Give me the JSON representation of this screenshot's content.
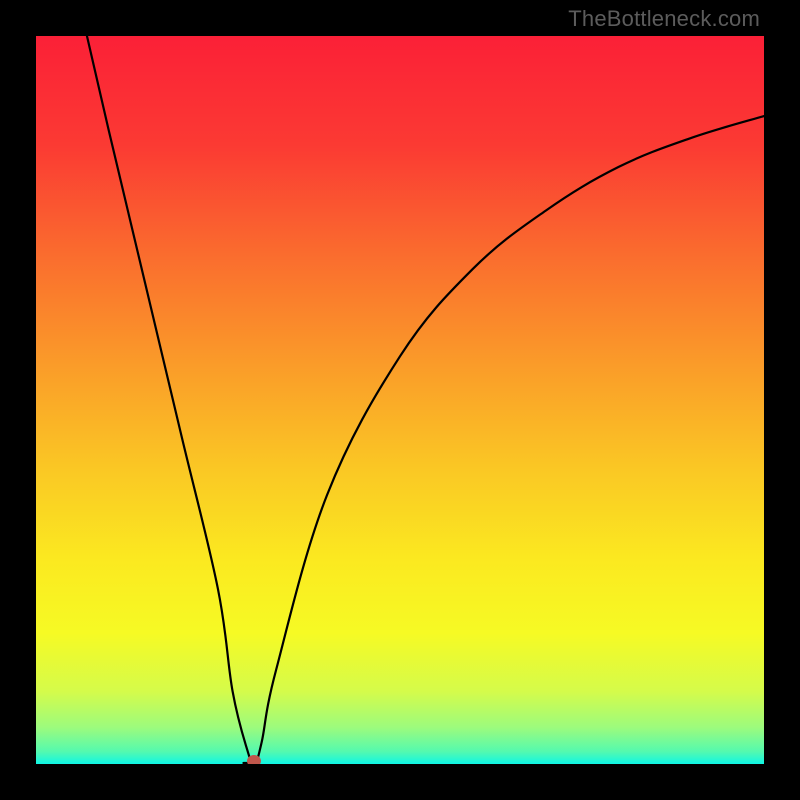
{
  "watermark": "TheBottleneck.com",
  "chart_data": {
    "type": "line",
    "title": "",
    "xlabel": "",
    "ylabel": "",
    "xlim": [
      0,
      100
    ],
    "ylim": [
      0,
      100
    ],
    "grid": false,
    "legend_position": "none",
    "series": [
      {
        "name": "bottleneck-curve",
        "x": [
          7,
          10,
          15,
          20,
          25,
          27,
          29,
          30,
          31,
          33,
          40,
          50,
          60,
          70,
          80,
          90,
          100
        ],
        "y": [
          100,
          87,
          66,
          45,
          24,
          10,
          2,
          0,
          3,
          13,
          37,
          56,
          68,
          76,
          82,
          86,
          89
        ]
      }
    ],
    "markers": [
      {
        "name": "optimum",
        "x": 30,
        "y": 0,
        "color": "#c0574c"
      }
    ],
    "background_gradient": {
      "stops": [
        {
          "pos": 0.0,
          "color": "#fb2037"
        },
        {
          "pos": 0.15,
          "color": "#fb3a33"
        },
        {
          "pos": 0.3,
          "color": "#fa6c2e"
        },
        {
          "pos": 0.45,
          "color": "#fa9b29"
        },
        {
          "pos": 0.6,
          "color": "#fac924"
        },
        {
          "pos": 0.72,
          "color": "#fbe920"
        },
        {
          "pos": 0.82,
          "color": "#f6fa24"
        },
        {
          "pos": 0.9,
          "color": "#d5fb4a"
        },
        {
          "pos": 0.95,
          "color": "#9cfb7d"
        },
        {
          "pos": 0.983,
          "color": "#54f9af"
        },
        {
          "pos": 1.0,
          "color": "#0ff6e5"
        }
      ]
    }
  }
}
